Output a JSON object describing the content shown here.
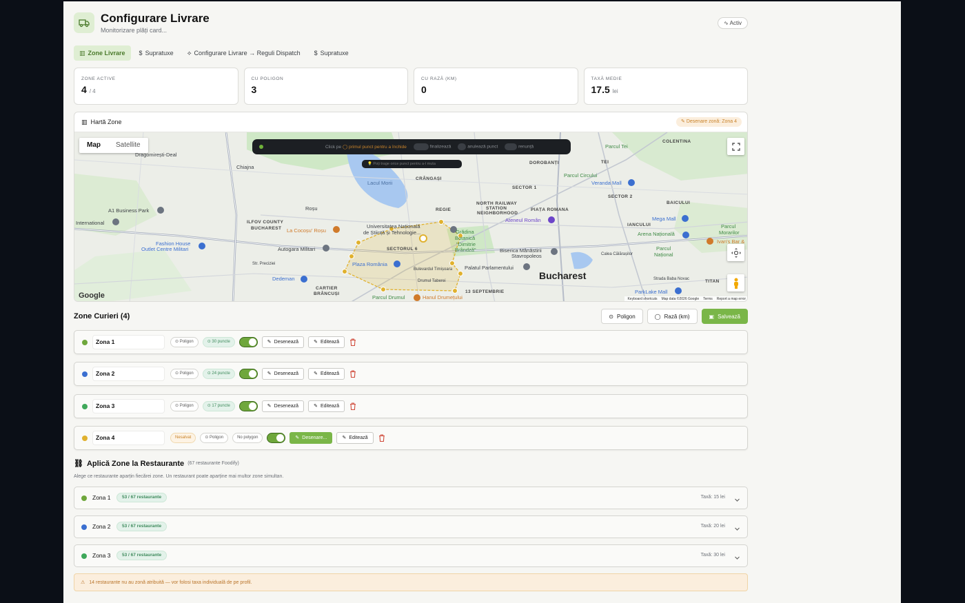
{
  "header": {
    "title": "Configurare Livrare",
    "subtitle": "Monitorizare plăți card...",
    "status_badge": "Activ"
  },
  "tabs": [
    {
      "label": "Zone Livrare",
      "icon": "map-icon",
      "active": true
    },
    {
      "label": "Supratuxe",
      "icon": "dollar-icon",
      "active": false
    },
    {
      "label": "Configurare Livrare → Reguli Dispatch",
      "icon": "dispatch-icon",
      "active": false
    },
    {
      "label": "Supratuxe",
      "icon": "dollar-icon",
      "active": false
    }
  ],
  "stats": [
    {
      "label": "ZONE ACTIVE",
      "value": "4",
      "unit": "/ 4"
    },
    {
      "label": "CU POLIGON",
      "value": "3",
      "unit": ""
    },
    {
      "label": "CU RAZĂ (KM)",
      "value": "0",
      "unit": ""
    },
    {
      "label": "TAXĂ MEDIE",
      "value": "17.5",
      "unit": "lei"
    }
  ],
  "map": {
    "title": "Hartă Zone",
    "drawing_badge": "Desenare zonă: Zona 4",
    "map_types": [
      "Map",
      "Satellite"
    ],
    "drawbar": {
      "hint_prefix": "Click pe",
      "hint_suffix": "primul punct pentru a închide",
      "finish": "finalizează",
      "undo": "anulează punct",
      "cancel": "renunță"
    },
    "tip": "Poți trage orice punct pentru a-l muta",
    "google": "Google",
    "attribution": [
      "Keyboard shortcuts",
      "Map data ©2026 Google",
      "Terms",
      "Report a map error"
    ],
    "labels": {
      "dragomiresti": "Dragomirești-Deal",
      "chiajna": "Chiajna",
      "rosu": "Roșu",
      "a1park": "A1 Business Park",
      "international": "International",
      "ilfov": "ILFOV COUNTY",
      "bucharest_small": "BUCHAREST",
      "lacocosu": "La Cocoșu' Roșu",
      "fashion1": "Fashion House",
      "fashion2": "Outlet Centre Militari",
      "autogara": "Autogara Militari",
      "univ1": "Universitatea Națională",
      "univ2": "de Știință și Tehnologie...",
      "sector6": "SECTORUL 6",
      "plaza": "Plaza România",
      "dedeman": "Dedeman",
      "cartier1": "CARTIER",
      "cartier2": "BRÂNCUȘI",
      "parcul_drumul": "Parcul Drumul",
      "hanul": "Hanul Drumețului",
      "gradina1": "Grădina",
      "gradina2": "Botanică",
      "gradina3": "\"Dimitrie",
      "gradina4": "Brândză\"",
      "lacul": "Lacul Morii",
      "crangasi": "CRÂNGAȘI",
      "regie": "REGIE",
      "north1": "NORTH RAILWAY",
      "north2": "STATION",
      "north3": "NEIGHBORHOOD",
      "ateneul": "Ateneul Român",
      "piata": "PIAȚA ROMANA",
      "dorobanti": "DOROBANȚI",
      "tei": "TEI",
      "parcul_tei": "Parcul Tei",
      "colentina": "COLENTINA",
      "parcul_circului": "Parcul Circului",
      "veranda": "Veranda Mall",
      "sector2": "SECTOR 2",
      "sector1": "SECTOR 1",
      "baicului": "BAICULUI",
      "iancului": "IANCULUI",
      "mega": "Mega Mall",
      "arena": "Arena Națională",
      "parcul_morarilor1": "Parcul",
      "parcul_morarilor2": "Morarilor",
      "ivans": "Ivan's Bar &",
      "parcul_national1": "Parcul",
      "parcul_national2": "Național",
      "calea": "Calea Călărașilor",
      "biserica1": "Biserica Mânăstirii",
      "biserica2": "Stavropoleos",
      "palatul": "Palatul Parlamentului",
      "bucharest": "Bucharest",
      "bd_timisoara": "Bulevardul Timișoara",
      "drumul_taberei": "Drumul Taberei",
      "13sept": "13 SEPTEMBRIE",
      "parklake": "ParkLake Mall",
      "titan": "TITAN",
      "baba_novac": "Strada Baba Novac",
      "str_preciziei": "Str. Preciziei"
    }
  },
  "zones_section": {
    "title": "Zone Curieri (4)",
    "btn_polygon": "Poligon",
    "btn_radius": "Rază (km)",
    "btn_save": "Salvează"
  },
  "zones": [
    {
      "name": "Zona 1",
      "color": "#6fa73c",
      "warn": "",
      "type": "Poligon",
      "points": "30 puncte",
      "draw": "Desenează",
      "edit": "Editează"
    },
    {
      "name": "Zona 2",
      "color": "#3b6fd0",
      "warn": "",
      "type": "Poligon",
      "points": "24 puncte",
      "draw": "Desenează",
      "edit": "Editează"
    },
    {
      "name": "Zona 3",
      "color": "#3fa85a",
      "warn": "",
      "type": "Poligon",
      "points": "17 puncte",
      "draw": "Desenează",
      "edit": "Editează"
    },
    {
      "name": "Zona 4",
      "color": "#e0b12e",
      "warn": "Nesalvat",
      "type": "Poligon",
      "points": "No polygon",
      "draw": "Desenare...",
      "edit": "Editează"
    }
  ],
  "apply": {
    "title": "Aplică Zone la Restaurante",
    "subtitle": "(67 restaurante Foodify)",
    "description": "Alege ce restaurante aparțin fiecărei zone. Un restaurant poate aparține mai multor zone simultan.",
    "rows": [
      {
        "name": "Zona 1",
        "color": "#6fa73c",
        "count": "53 / 67 restaurante",
        "tax": "Taxă: 15 lei"
      },
      {
        "name": "Zona 2",
        "color": "#3b6fd0",
        "count": "53 / 67 restaurante",
        "tax": "Taxă: 20 lei"
      },
      {
        "name": "Zona 3",
        "color": "#3fa85a",
        "count": "53 / 67 restaurante",
        "tax": "Taxă: 30 lei"
      }
    ],
    "warning": "14 restaurante nu au zonă atribuită — vor folosi taxa individuală de pe profil."
  }
}
